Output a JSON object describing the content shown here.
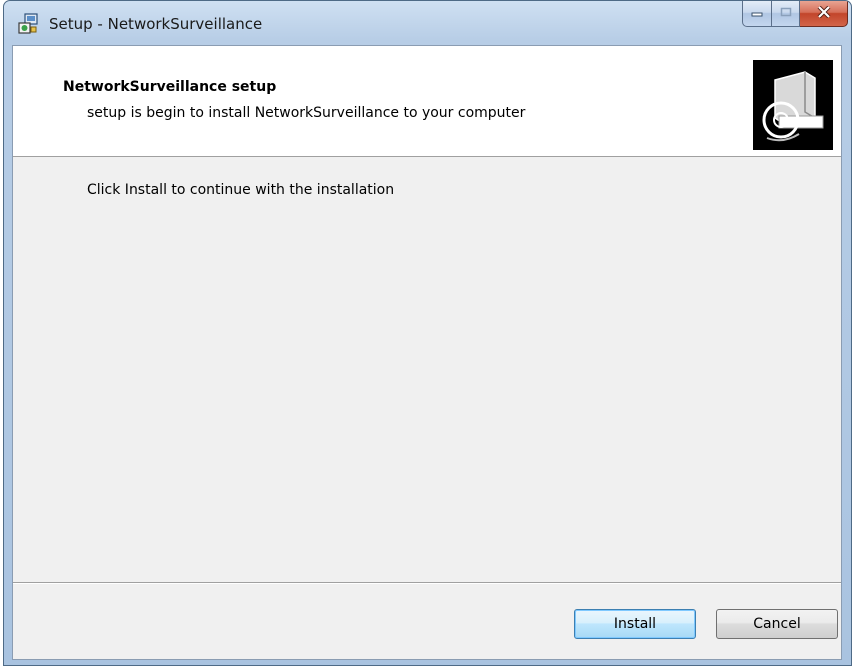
{
  "window": {
    "title": "Setup - NetworkSurveillance",
    "caption_buttons": [
      "minimize-icon",
      "maximize-icon",
      "close-icon"
    ]
  },
  "header": {
    "title": "NetworkSurveillance setup",
    "subtitle": "setup is begin to install NetworkSurveillance to your computer",
    "image_icon": "computer-cd-icon"
  },
  "body": {
    "instruction": "Click Install to continue with the installation"
  },
  "buttons": {
    "install_label": "Install",
    "cancel_label": "Cancel"
  },
  "colors": {
    "window_frame": "#a9c3e0",
    "content_bg": "#f0f0f0",
    "header_bg": "#ffffff",
    "close_button": "#c2452b",
    "default_button_border": "#3c7fb1"
  }
}
